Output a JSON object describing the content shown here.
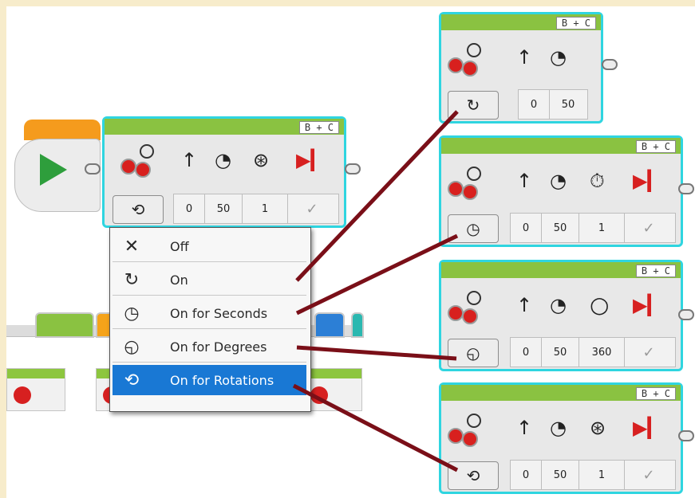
{
  "main_block": {
    "ports": "B + C",
    "values": [
      "0",
      "50",
      "1"
    ],
    "mode_icon": "rotations-icon"
  },
  "menu": {
    "items": [
      {
        "label": "Off",
        "icon": "close-icon"
      },
      {
        "label": "On",
        "icon": "rotate-icon"
      },
      {
        "label": "On for Seconds",
        "icon": "clock-icon"
      },
      {
        "label": "On for Degrees",
        "icon": "degrees-icon"
      },
      {
        "label": "On for Rotations",
        "icon": "rotations-icon",
        "selected": true
      }
    ]
  },
  "example_blocks": [
    {
      "ports": "B + C",
      "values": [
        "0",
        "50"
      ],
      "mode": "On"
    },
    {
      "ports": "B + C",
      "values": [
        "0",
        "50",
        "1"
      ],
      "mode": "On for Seconds"
    },
    {
      "ports": "B + C",
      "values": [
        "0",
        "50",
        "360"
      ],
      "mode": "On for Degrees"
    },
    {
      "ports": "B + C",
      "values": [
        "0",
        "50",
        "1"
      ],
      "mode": "On for Rotations"
    }
  ],
  "connector_color": "#7a0f18",
  "accent_cyan": "#2fd5e0",
  "menu_highlight": "#1978d4"
}
